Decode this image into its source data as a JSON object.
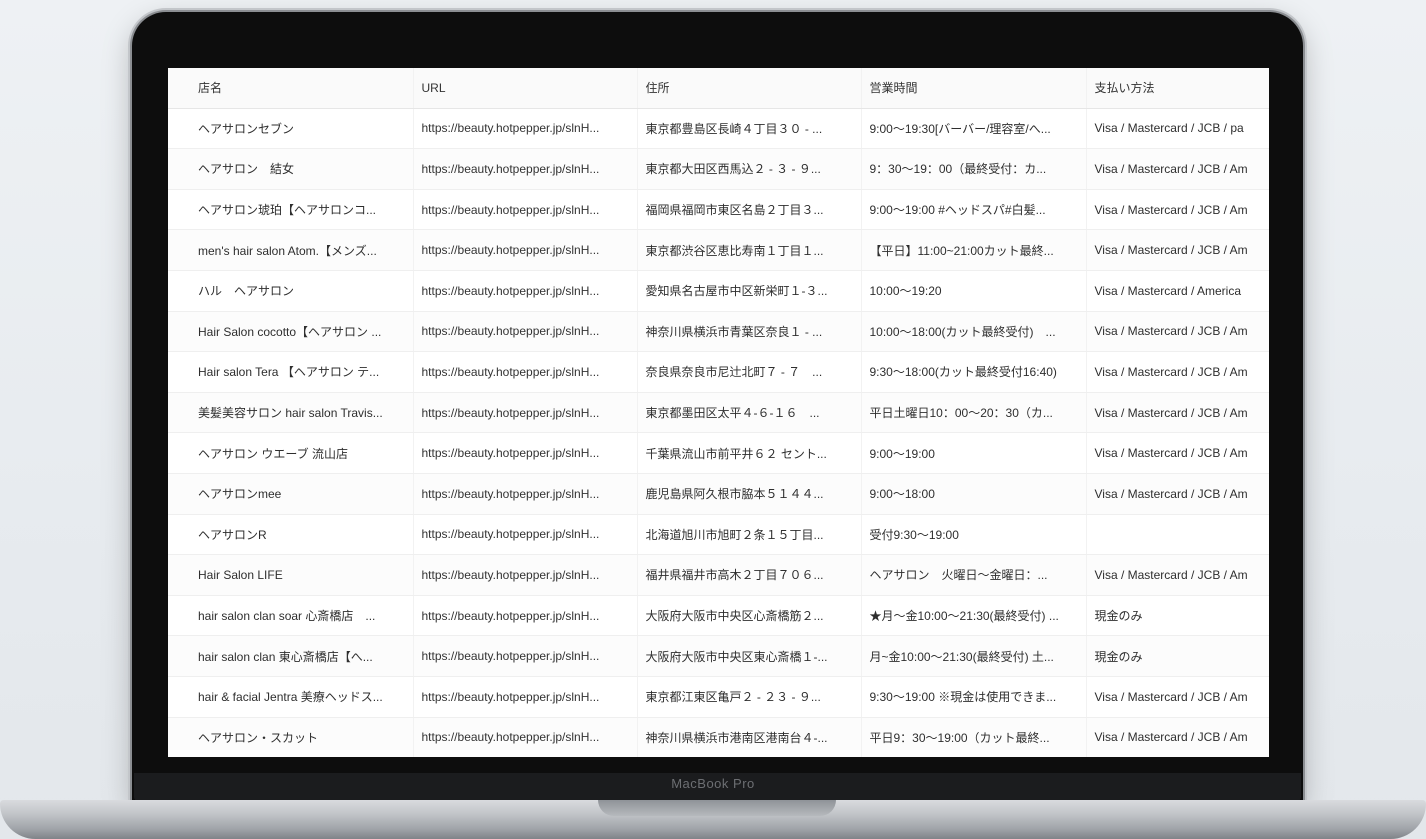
{
  "device": {
    "label": "MacBook Pro"
  },
  "table": {
    "headers": [
      "店名",
      "URL",
      "住所",
      "営業時間",
      "支払い方法"
    ],
    "rows": [
      [
        "ヘアサロンセブン",
        "https://beauty.hotpepper.jp/slnH...",
        "東京都豊島区長崎４丁目３０ - ...",
        "9:00～19:30[バーバー/理容室/へ...",
        "Visa / Mastercard / JCB / pa"
      ],
      [
        "ヘアサロン　結女",
        "https://beauty.hotpepper.jp/slnH...",
        "東京都大田区西馬込２ - ３ - ９...",
        "9：30～19：00（最終受付：カ...",
        "Visa / Mastercard / JCB / Am"
      ],
      [
        "ヘアサロン琥珀【ヘアサロンコ...",
        "https://beauty.hotpepper.jp/slnH...",
        "福岡県福岡市東区名島２丁目３...",
        "9:00～19:00 #ヘッドスパ#白髪...",
        "Visa / Mastercard / JCB / Am"
      ],
      [
        "men's hair salon Atom.【メンズ...",
        "https://beauty.hotpepper.jp/slnH...",
        "東京都渋谷区恵比寿南１丁目１...",
        "【平日】11:00~21:00カット最終...",
        "Visa / Mastercard / JCB / Am"
      ],
      [
        "ハル　ヘアサロン",
        "https://beauty.hotpepper.jp/slnH...",
        "愛知県名古屋市中区新栄町１-３...",
        "10:00～19:20",
        "Visa / Mastercard / America"
      ],
      [
        "Hair Salon cocotto【ヘアサロン ...",
        "https://beauty.hotpepper.jp/slnH...",
        "神奈川県横浜市青葉区奈良１ - ...",
        "10:00～18:00(カット最終受付)　...",
        "Visa / Mastercard / JCB / Am"
      ],
      [
        "Hair salon Tera 【ヘアサロン テ...",
        "https://beauty.hotpepper.jp/slnH...",
        "奈良県奈良市尼辻北町７ - ７　...",
        "9:30～18:00(カット最終受付16:40)",
        "Visa / Mastercard / JCB / Am"
      ],
      [
        "美髪美容サロン hair salon Travis...",
        "https://beauty.hotpepper.jp/slnH...",
        "東京都墨田区太平４-６-１６　...",
        "平日土曜日10：00～20：30（カ...",
        "Visa / Mastercard / JCB / Am"
      ],
      [
        "ヘアサロン ウエーブ 流山店",
        "https://beauty.hotpepper.jp/slnH...",
        "千葉県流山市前平井６２ セント...",
        "9:00～19:00",
        "Visa / Mastercard / JCB / Am"
      ],
      [
        "ヘアサロンmee",
        "https://beauty.hotpepper.jp/slnH...",
        "鹿児島県阿久根市脇本５１４４...",
        "9:00～18:00",
        "Visa / Mastercard / JCB / Am"
      ],
      [
        "ヘアサロンR",
        "https://beauty.hotpepper.jp/slnH...",
        "北海道旭川市旭町２条１５丁目...",
        "受付9:30～19:00",
        ""
      ],
      [
        "Hair Salon LIFE",
        "https://beauty.hotpepper.jp/slnH...",
        "福井県福井市高木２丁目７０６...",
        "ヘアサロン　火曜日～金曜日：...",
        "Visa / Mastercard / JCB / Am"
      ],
      [
        "hair salon clan soar 心斎橋店　...",
        "https://beauty.hotpepper.jp/slnH...",
        "大阪府大阪市中央区心斎橋筋２...",
        "★月～金10:00～21:30(最終受付) ...",
        "現金のみ"
      ],
      [
        "hair salon clan 東心斎橋店【へ...",
        "https://beauty.hotpepper.jp/slnH...",
        "大阪府大阪市中央区東心斎橋１-...",
        "月~金10:00～21:30(最終受付) 土...",
        "現金のみ"
      ],
      [
        "hair & facial Jentra 美療ヘッドス...",
        "https://beauty.hotpepper.jp/slnH...",
        "東京都江東区亀戸２ - ２３ - ９...",
        "9:30～19:00 ※現金は使用できま...",
        "Visa / Mastercard / JCB / Am"
      ],
      [
        "ヘアサロン・スカット",
        "https://beauty.hotpepper.jp/slnH...",
        "神奈川県横浜市港南区港南台４-...",
        "平日9：30～19:00（カット最終...",
        "Visa / Mastercard / JCB / Am"
      ]
    ]
  }
}
